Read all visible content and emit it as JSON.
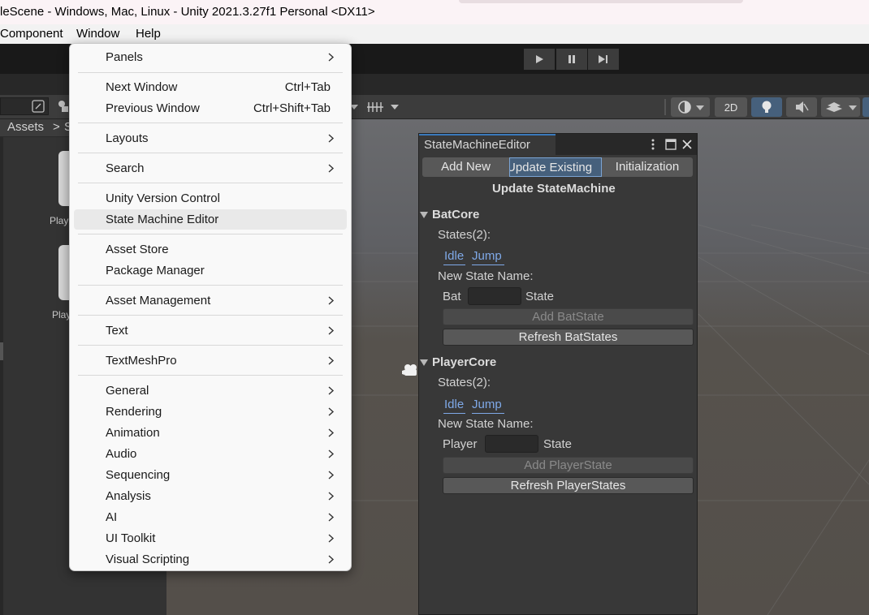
{
  "window": {
    "title": "leScene - Windows, Mac, Linux - Unity 2021.3.27f1 Personal <DX11>"
  },
  "menubar": {
    "items": [
      "Component",
      "Window",
      "Help"
    ]
  },
  "toolbar": {
    "btn_2d": "2D"
  },
  "project": {
    "breadcrumb_root": "Assets",
    "breadcrumb_sep": ">",
    "breadcrumb_next": "S",
    "asset1_label": "Play",
    "asset2_label": "Play"
  },
  "window_menu": {
    "items": [
      {
        "label": "Panels",
        "shortcut": ""
      },
      {
        "label": "Next Window",
        "shortcut": "Ctrl+Tab"
      },
      {
        "label": "Previous Window",
        "shortcut": "Ctrl+Shift+Tab"
      },
      {
        "label": "Layouts",
        "shortcut": ""
      },
      {
        "label": "Search",
        "shortcut": ""
      },
      {
        "label": "Unity Version Control",
        "shortcut": ""
      },
      {
        "label": "State Machine Editor",
        "shortcut": ""
      },
      {
        "label": "Asset Store",
        "shortcut": ""
      },
      {
        "label": "Package Manager",
        "shortcut": ""
      },
      {
        "label": "Asset Management",
        "shortcut": ""
      },
      {
        "label": "Text",
        "shortcut": ""
      },
      {
        "label": "TextMeshPro",
        "shortcut": ""
      },
      {
        "label": "General",
        "shortcut": ""
      },
      {
        "label": "Rendering",
        "shortcut": ""
      },
      {
        "label": "Animation",
        "shortcut": ""
      },
      {
        "label": "Audio",
        "shortcut": ""
      },
      {
        "label": "Sequencing",
        "shortcut": ""
      },
      {
        "label": "Analysis",
        "shortcut": ""
      },
      {
        "label": "AI",
        "shortcut": ""
      },
      {
        "label": "UI Toolkit",
        "shortcut": ""
      },
      {
        "label": "Visual Scripting",
        "shortcut": ""
      }
    ]
  },
  "sm_editor": {
    "tab_title": "StateMachineEditor",
    "tabs": [
      "Add New",
      "Update Existing",
      "Initialization"
    ],
    "heading": "Update StateMachine",
    "bat": {
      "name": "BatCore",
      "states_label": "States(2):",
      "states": [
        "Idle",
        "Jump"
      ],
      "new_state_label": "New State Name:",
      "prefix": "Bat",
      "suffix": "State",
      "input_value": "",
      "add_button": "Add BatState",
      "refresh_button": "Refresh BatStates"
    },
    "player": {
      "name": "PlayerCore",
      "states_label": "States(2):",
      "states": [
        "Idle",
        "Jump"
      ],
      "new_state_label": "New State Name:",
      "prefix": "Player",
      "suffix": "State",
      "input_value": "",
      "add_button": "Add PlayerState",
      "refresh_button": "Refresh PlayerStates"
    }
  }
}
